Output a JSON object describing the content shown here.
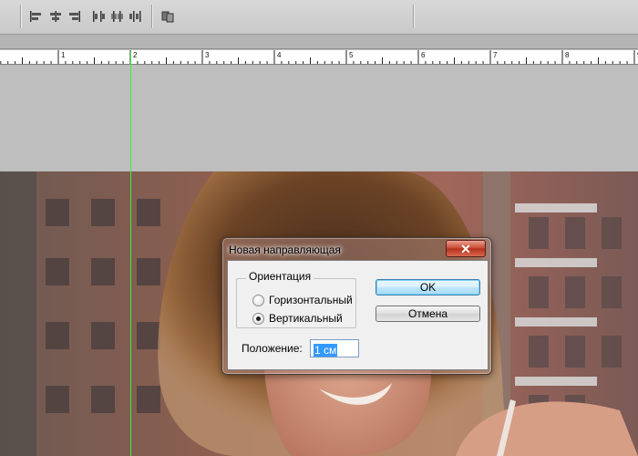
{
  "toolbar": {
    "icons": [
      "align-left-edges-icon",
      "align-horizontal-centers-icon",
      "align-right-edges-icon",
      "distribute-left-icon",
      "distribute-centers-icon",
      "distribute-right-icon",
      "auto-align-layers-icon"
    ]
  },
  "ruler": {
    "unit": "cm",
    "labels": [
      "1",
      "2",
      "3",
      "4",
      "5",
      "6",
      "7",
      "8",
      "9"
    ]
  },
  "dialog": {
    "title": "Новая направляющая",
    "close_icon": "close-icon",
    "orientation": {
      "legend": "Ориентация",
      "options": [
        {
          "label": "Горизонтальный",
          "checked": false
        },
        {
          "label": "Вертикальный",
          "checked": true
        }
      ]
    },
    "position": {
      "label": "Положение:",
      "value": "1 см"
    },
    "buttons": {
      "ok": "OK",
      "cancel": "Отмена"
    }
  },
  "colors": {
    "guide": "#3cf03c",
    "selection": "#3399ff",
    "close_button": "#c8452e"
  }
}
